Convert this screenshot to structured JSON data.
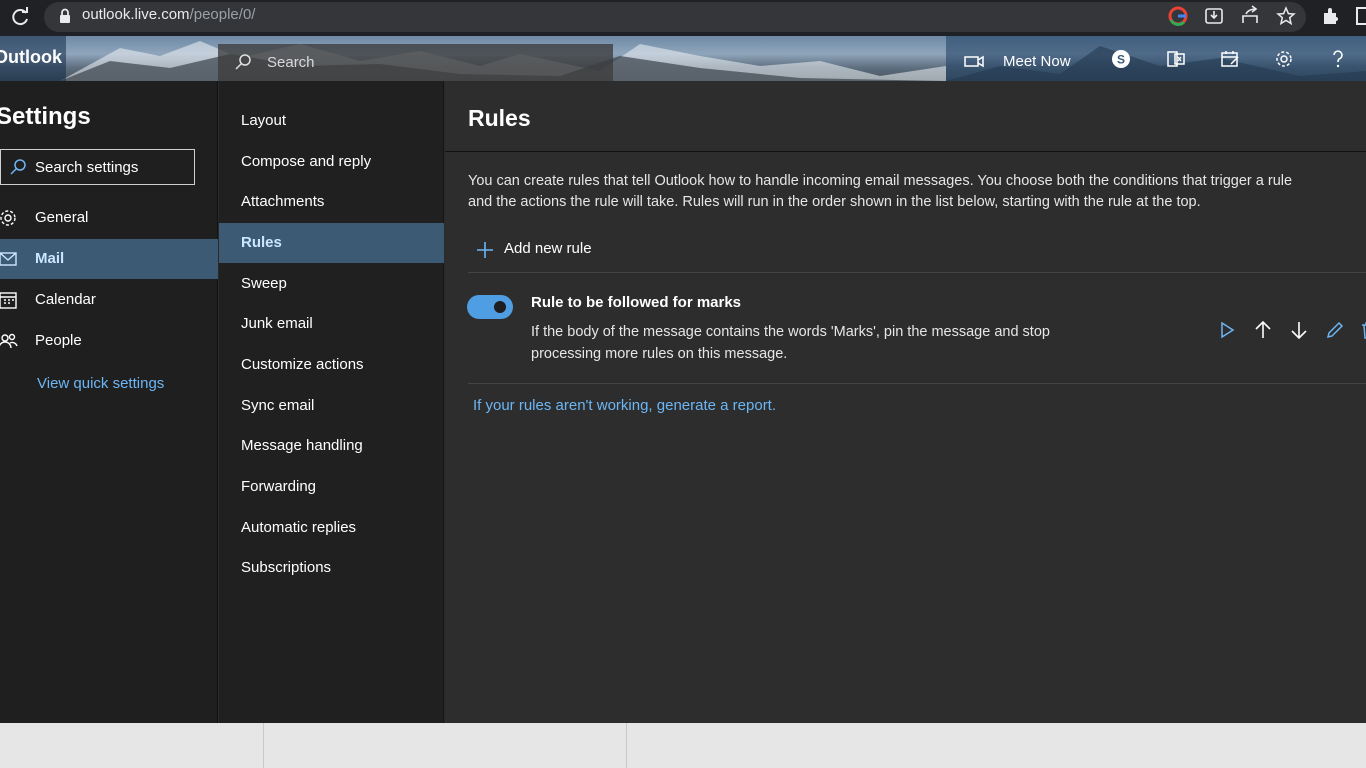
{
  "browser": {
    "url_host": "outlook.live.com",
    "url_path": "/people/0/"
  },
  "header": {
    "brand": "Outlook",
    "search_placeholder": "Search",
    "meet_now_label": "Meet Now"
  },
  "settings": {
    "title": "Settings",
    "search_placeholder": "Search settings",
    "nav": [
      {
        "label": "General",
        "icon": "gear-icon",
        "selected": false
      },
      {
        "label": "Mail",
        "icon": "mail-icon",
        "selected": true
      },
      {
        "label": "Calendar",
        "icon": "calendar-icon",
        "selected": false
      },
      {
        "label": "People",
        "icon": "people-icon",
        "selected": false
      }
    ],
    "quick_settings_link": "View quick settings"
  },
  "mail_settings": {
    "items": [
      {
        "label": "Layout"
      },
      {
        "label": "Compose and reply"
      },
      {
        "label": "Attachments"
      },
      {
        "label": "Rules",
        "selected": true
      },
      {
        "label": "Sweep"
      },
      {
        "label": "Junk email"
      },
      {
        "label": "Customize actions"
      },
      {
        "label": "Sync email"
      },
      {
        "label": "Message handling"
      },
      {
        "label": "Forwarding"
      },
      {
        "label": "Automatic replies"
      },
      {
        "label": "Subscriptions"
      }
    ]
  },
  "rules": {
    "title": "Rules",
    "description_line1": "You can create rules that tell Outlook how to handle incoming email messages. You choose both the conditions that trigger a rule",
    "description_line2": "and the actions the rule will take. Rules will run in the order shown in the list below, starting with the rule at the top.",
    "add_rule_label": "Add new rule",
    "rule_list": [
      {
        "name": "Rule to be followed for marks",
        "enabled": true,
        "description_line1": "If the body of the message contains the words 'Marks', pin the message and stop",
        "description_line2": "processing more rules on this message."
      }
    ],
    "report_link": "If your rules aren't working, generate a report."
  },
  "colors": {
    "accent": "#4f9ee3",
    "link": "#6cb6f5",
    "selected_bg": "#3c5a73"
  }
}
